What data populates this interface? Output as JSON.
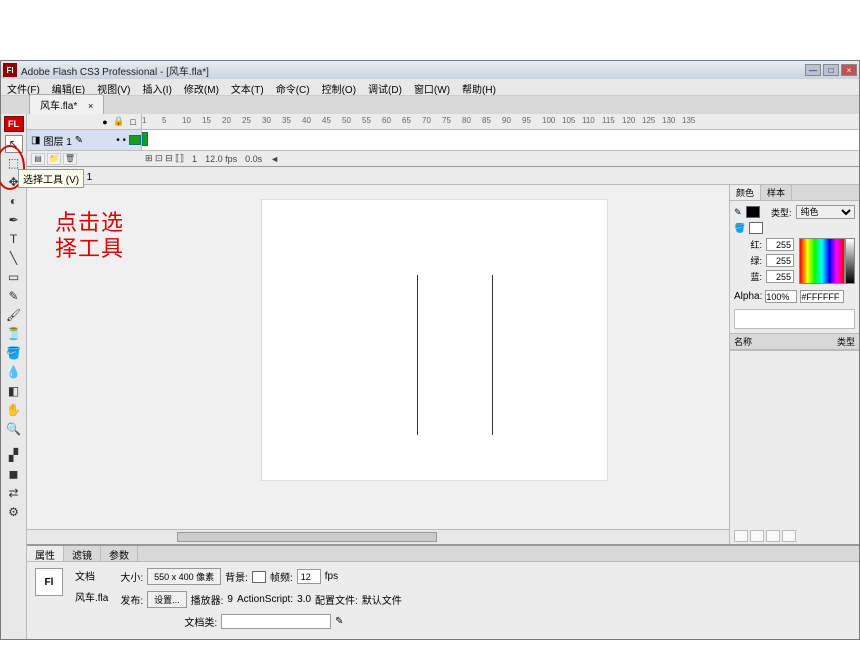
{
  "titlebar": {
    "logo": "Fl",
    "title": "Adobe Flash CS3 Professional - [风车.fla*]",
    "btns": {
      "min": "—",
      "max": "□",
      "close": "×"
    }
  },
  "menus": [
    "文件(F)",
    "编辑(E)",
    "视图(V)",
    "插入(I)",
    "修改(M)",
    "文本(T)",
    "命令(C)",
    "控制(O)",
    "调试(D)",
    "窗口(W)",
    "帮助(H)"
  ],
  "doctab": {
    "name": "风车.fla*",
    "close": "×"
  },
  "tool_logo": "FL",
  "tooltip": "选择工具 (V)",
  "annotation": "点击选\n择工具",
  "timeline": {
    "layer_name": "图层 1",
    "status": {
      "frame": "1",
      "fps": "12.0 fps",
      "time": "0.0s"
    },
    "icons": {
      "eye": "●",
      "lock": "🔒",
      "box": "□"
    }
  },
  "frame_numbers": [
    1,
    5,
    10,
    15,
    20,
    25,
    30,
    35,
    40,
    45,
    50,
    55,
    60,
    65,
    70,
    75,
    80,
    85,
    90,
    95,
    100,
    105,
    110,
    115,
    120,
    125,
    130,
    135
  ],
  "scene": {
    "label": "场景 1"
  },
  "colorpanel": {
    "tabs": [
      "颜色",
      "样本"
    ],
    "type_label": "类型:",
    "type_value": "纯色",
    "r_label": "红:",
    "r": "255",
    "g_label": "绿:",
    "g": "255",
    "b_label": "蓝:",
    "b": "255",
    "alpha_label": "Alpha:",
    "alpha": "100%",
    "hex": "#FFFFFF"
  },
  "libpanel": {
    "hdr": "名称",
    "hdr2": "类型"
  },
  "props": {
    "tabs": [
      "属性",
      "滤镜",
      "参数"
    ],
    "doc_label": "文档",
    "doc_name": "风车.fla",
    "size_label": "大小:",
    "size_btn": "550 x 400 像素",
    "bg_label": "背景:",
    "fps_label": "帧频:",
    "fps": "12",
    "fps_unit": "fps",
    "publish_label": "发布:",
    "publish_btn": "设置...",
    "player_label": "播放器:",
    "player": "9",
    "as_label": "ActionScript:",
    "as": "3.0",
    "profile_label": "配置文件:",
    "profile": "默认文件",
    "docclass_label": "文档类:"
  }
}
